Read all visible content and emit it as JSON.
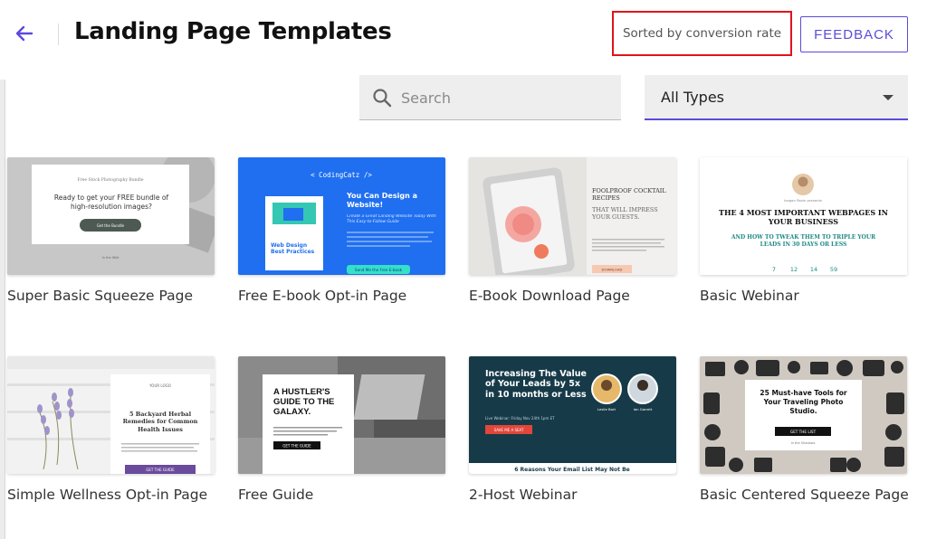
{
  "header": {
    "title": "Landing Page Templates",
    "sorted_label": "Sorted by conversion rate",
    "feedback_label": "FEEDBACK"
  },
  "search": {
    "placeholder": "Search"
  },
  "filter": {
    "selected": "All Types"
  },
  "colors": {
    "accent": "#5b4bdb",
    "highlight_box": "#e0141b"
  },
  "templates": [
    {
      "name": "Super Basic Squeeze Page",
      "thumb": {
        "kicker": "Free Stock Photography Bundle",
        "headline": "Ready to get your FREE bundle of high-resolution images?",
        "button": "Get the Bundle",
        "footer": "In the Wild"
      }
    },
    {
      "name": "Free E-book Opt-in Page",
      "thumb": {
        "brand": "< CodingCatz />",
        "headline": "You Can Design a Website!",
        "sub": "Create a Great Landing Website Today With This Easy-to-Follow Guide",
        "book": "Web Design Best Practices",
        "button": "Send Me the Free E-book"
      }
    },
    {
      "name": "E-Book Download Page",
      "thumb": {
        "headline": "FOOLPROOF COCKTAIL RECIPES",
        "sub": "THAT WILL IMPRESS YOUR GUESTS.",
        "button": "DOWNLOAD"
      }
    },
    {
      "name": "Basic Webinar",
      "thumb": {
        "presenter": "Ivegan Rozin presents",
        "headline": "THE 4 MOST IMPORTANT WEBPAGES IN YOUR BUSINESS",
        "sub": "AND HOW TO TWEAK THEM TO TRIPLE YOUR LEADS IN 30 DAYS OR LESS",
        "countdown": [
          "7",
          "12",
          "14",
          "59"
        ]
      }
    },
    {
      "name": "Simple Wellness Opt-in Page",
      "thumb": {
        "logo": "YOUR LOGO",
        "headline": "5 Backyard Herbal Remedies for Common Health Issues",
        "button": "GET THE GUIDE"
      }
    },
    {
      "name": "Free Guide",
      "thumb": {
        "headline": "A HUSTLER'S GUIDE TO THE GALAXY.",
        "button": "GET THE GUIDE"
      }
    },
    {
      "name": "2-Host Webinar",
      "thumb": {
        "headline": "Increasing The Value of Your Leads by 5x in 10 months or Less",
        "date": "Live Webinar: Friday Nov 24th 1pm ET",
        "button": "SAVE ME A SEAT",
        "host1": "Leslie Bart",
        "host2": "Ian Garrett",
        "footer": "6 Reasons Your Email List May Not Be"
      }
    },
    {
      "name": "Basic Centered Squeeze Page",
      "thumb": {
        "headline": "25 Must-have Tools for Your Traveling Photo Studio.",
        "button": "GET THE LIST",
        "footer": "In the Shadows"
      }
    }
  ]
}
